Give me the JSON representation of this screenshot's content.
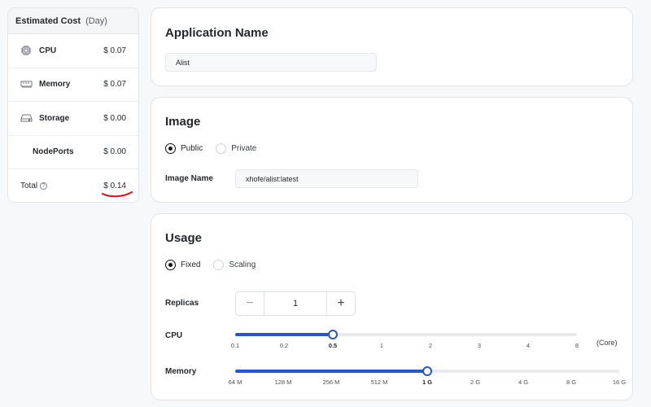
{
  "cost": {
    "header_title": "Estimated Cost",
    "header_period": "(Day)",
    "rows": [
      {
        "label": "CPU",
        "value": "$ 0.07",
        "icon": "cpu-icon"
      },
      {
        "label": "Memory",
        "value": "$ 0.07",
        "icon": "memory-icon"
      },
      {
        "label": "Storage",
        "value": "$ 0.00",
        "icon": "storage-icon"
      },
      {
        "label": "NodePorts",
        "value": "$ 0.00"
      },
      {
        "label": "Total",
        "value": "$ 0.14",
        "icon": "help-icon"
      }
    ],
    "accent": "#d4151c"
  },
  "app_name": {
    "title": "Application Name",
    "value": "Alist"
  },
  "image": {
    "title": "Image",
    "options": [
      "Public",
      "Private"
    ],
    "selected": "Public",
    "image_name_label": "Image Name",
    "image_name_value": "xhofe/alist:latest"
  },
  "usage": {
    "title": "Usage",
    "options": [
      "Fixed",
      "Scaling"
    ],
    "selected": "Fixed",
    "replicas_label": "Replicas",
    "replicas_value": "1",
    "minus": "−",
    "plus": "+",
    "cpu_label": "CPU",
    "cpu_ticks": [
      "0.1",
      "0.2",
      "0.5",
      "1",
      "2",
      "3",
      "4",
      "8"
    ],
    "cpu_selected_index": 2,
    "cpu_unit": "(Core)",
    "memory_label": "Memory",
    "memory_ticks": [
      "64 M",
      "128 M",
      "256 M",
      "512 M",
      "1 G",
      "2 G",
      "4 G",
      "8 G",
      "16 G"
    ],
    "memory_selected_index": 4,
    "accent": "#2356d4"
  }
}
